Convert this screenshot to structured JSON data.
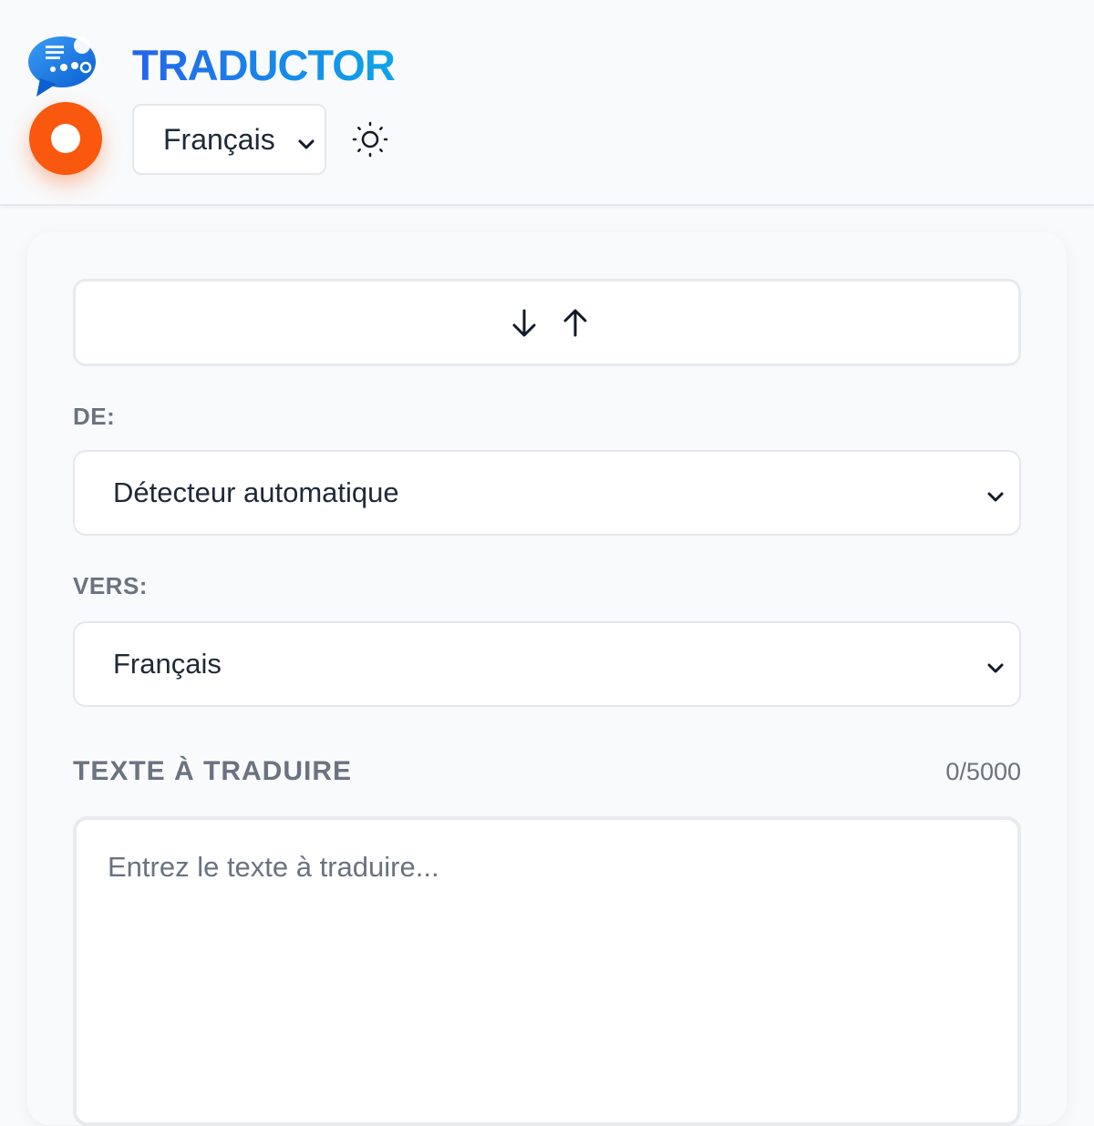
{
  "header": {
    "app_title": "TRADUCTOR",
    "ui_language": "Français",
    "icons": {
      "logo": "chat-bubble-logo-icon",
      "record": "record-icon",
      "theme": "sun-icon"
    }
  },
  "main": {
    "swap_icons": [
      "arrow-down-icon",
      "arrow-up-icon"
    ],
    "from_label": "DE:",
    "from_value": "Détecteur automatique",
    "to_label": "VERS:",
    "to_value": "Français",
    "input_title": "TEXTE À TRADUIRE",
    "char_count": "0/5000",
    "input_placeholder": "Entrez le texte à traduire..."
  },
  "colors": {
    "brand_gradient_start": "#2563eb",
    "brand_gradient_end": "#0ea5e9",
    "record_button": "#f9580e",
    "label_gray": "#6b7280",
    "background": "#f9fafb"
  }
}
